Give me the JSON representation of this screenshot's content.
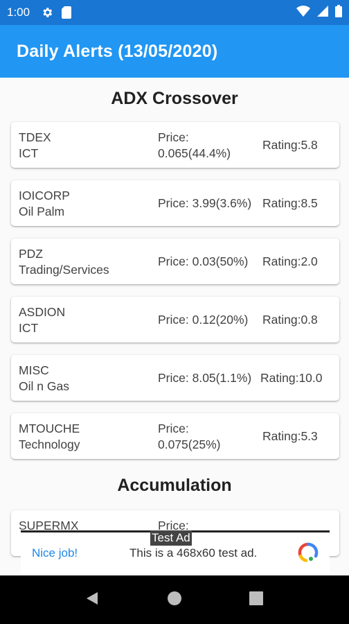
{
  "status_bar": {
    "time": "1:00",
    "icons": [
      "gear-icon",
      "sd-card-icon",
      "wifi-icon",
      "signal-icon",
      "battery-icon"
    ]
  },
  "app_bar": {
    "title": "Daily Alerts (13/05/2020)"
  },
  "sections": [
    {
      "title": "ADX Crossover",
      "items": [
        {
          "symbol": "TDEX",
          "sector": "ICT",
          "price_label": "Price:",
          "price_value": "0.065(44.4%)",
          "rating": "Rating:5.8"
        },
        {
          "symbol": "IOICORP",
          "sector": "Oil Palm",
          "price": "Price: 3.99(3.6%)",
          "rating": "Rating:8.5"
        },
        {
          "symbol": "PDZ",
          "sector": "Trading/Services",
          "price": "Price: 0.03(50%)",
          "rating": "Rating:2.0"
        },
        {
          "symbol": "ASDION",
          "sector": "ICT",
          "price": "Price: 0.12(20%)",
          "rating": "Rating:0.8"
        },
        {
          "symbol": "MISC",
          "sector": "Oil n Gas",
          "price": "Price: 8.05(1.1%)",
          "rating": "Rating:10.0"
        },
        {
          "symbol": "MTOUCHE",
          "sector": "Technology",
          "price_label": "Price:",
          "price_value": "0.075(25%)",
          "rating": "Rating:5.3"
        }
      ]
    },
    {
      "title": "Accumulation",
      "items": [
        {
          "symbol": "SUPERMX",
          "price_label": "Price:"
        }
      ]
    }
  ],
  "ad": {
    "label": "Test Ad",
    "cta": "Nice job!",
    "text": "This is a 468x60 test ad.",
    "logo_icon": "ad-choices-logo-icon"
  },
  "nav_bar": {
    "icons": [
      "back-icon",
      "home-icon",
      "recents-icon"
    ]
  },
  "colors": {
    "app_bar": "#2196f3",
    "status_bar": "#1976d2",
    "background": "#fafafa"
  }
}
